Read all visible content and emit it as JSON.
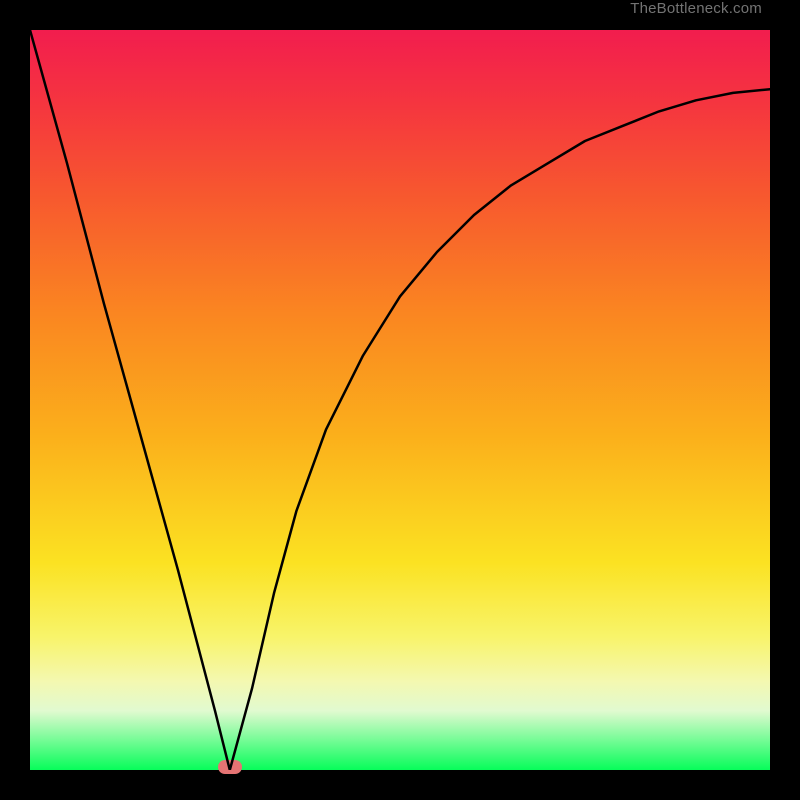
{
  "attribution": "TheBottleneck.com",
  "chart_data": {
    "type": "line",
    "title": "",
    "xlabel": "",
    "ylabel": "",
    "xlim": [
      0,
      100
    ],
    "ylim": [
      0,
      100
    ],
    "x": [
      0,
      5,
      10,
      15,
      20,
      25,
      27,
      30,
      33,
      36,
      40,
      45,
      50,
      55,
      60,
      65,
      70,
      75,
      80,
      85,
      90,
      95,
      100
    ],
    "values": [
      100,
      82,
      63,
      45,
      27,
      8,
      0,
      11,
      24,
      35,
      46,
      56,
      64,
      70,
      75,
      79,
      82,
      85,
      87,
      89,
      90.5,
      91.5,
      92
    ],
    "minimum_point": {
      "x": 27,
      "y": 0
    },
    "annotations": [
      {
        "type": "marker",
        "x": 27,
        "y": 0,
        "shape": "pill",
        "color": "#e57373"
      }
    ]
  },
  "marker": {
    "left_pct": 27,
    "bottom_pct": 1
  }
}
